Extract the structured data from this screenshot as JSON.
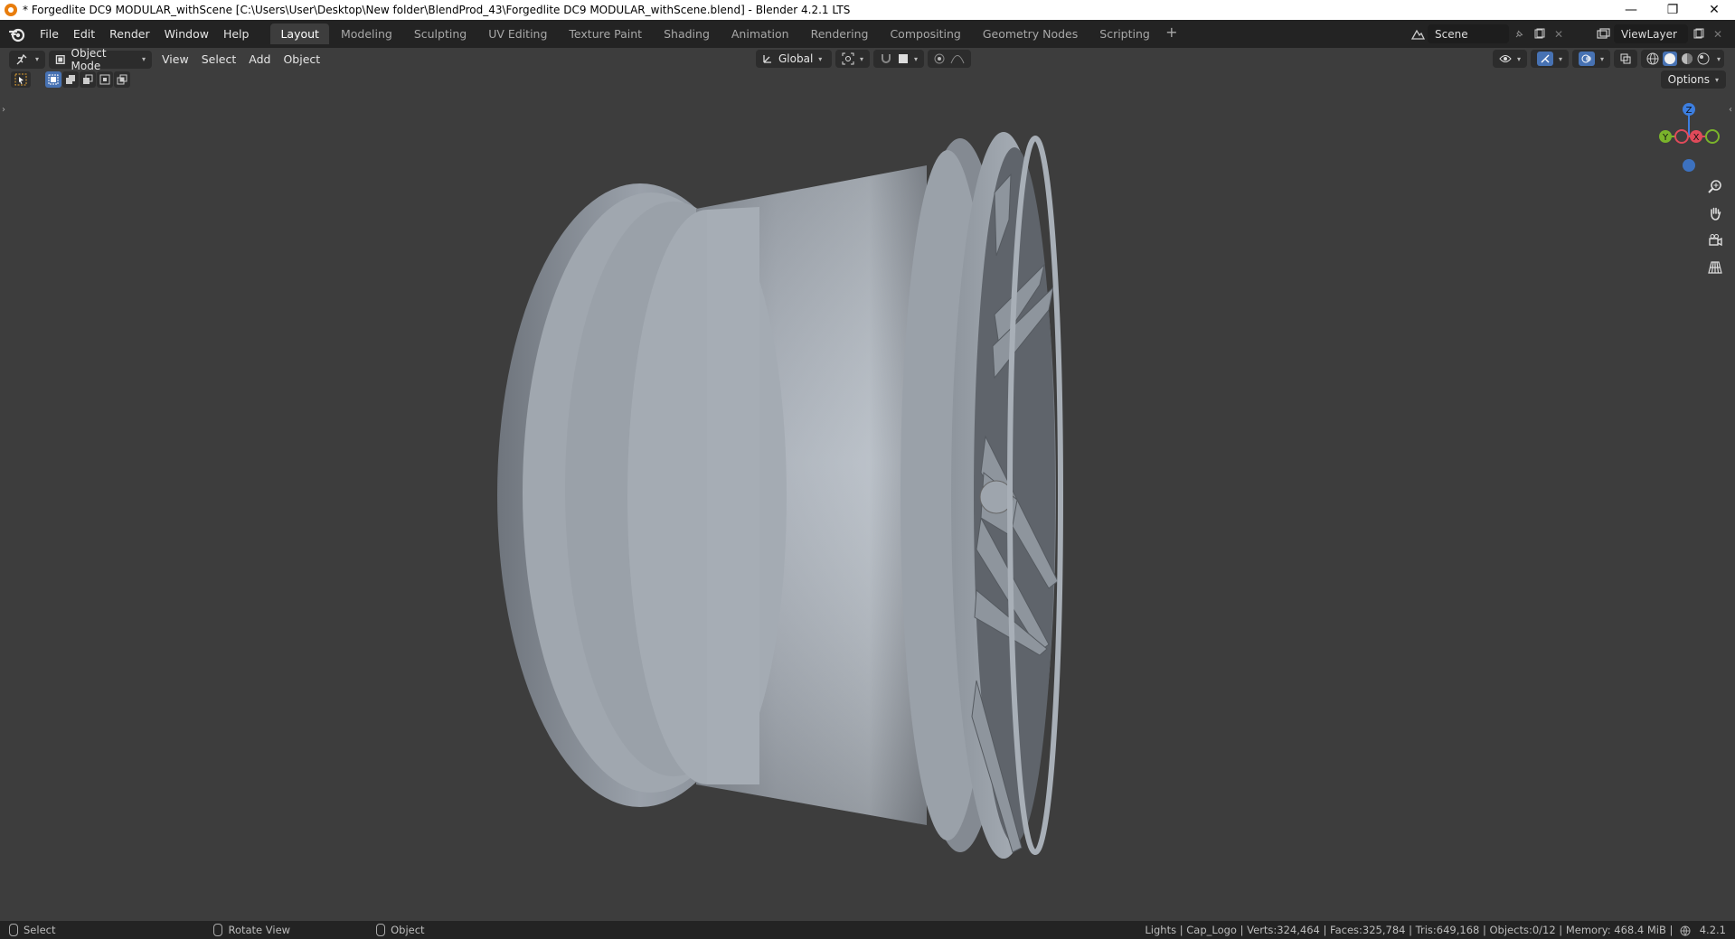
{
  "window": {
    "title": "* Forgedlite DC9 MODULAR_withScene [C:\\Users\\User\\Desktop\\New folder\\BlendProd_43\\Forgedlite DC9 MODULAR_withScene.blend] - Blender 4.2.1 LTS",
    "minimize": "—",
    "restore": "❐",
    "close": "✕"
  },
  "menu": [
    "File",
    "Edit",
    "Render",
    "Window",
    "Help"
  ],
  "workspaces": [
    {
      "label": "Layout",
      "active": true
    },
    {
      "label": "Modeling"
    },
    {
      "label": "Sculpting"
    },
    {
      "label": "UV Editing"
    },
    {
      "label": "Texture Paint"
    },
    {
      "label": "Shading"
    },
    {
      "label": "Animation"
    },
    {
      "label": "Rendering"
    },
    {
      "label": "Compositing"
    },
    {
      "label": "Geometry Nodes"
    },
    {
      "label": "Scripting"
    }
  ],
  "workspace_add": "+",
  "scene": {
    "label": "Scene"
  },
  "view_layer": {
    "label": "ViewLayer"
  },
  "viewport_header": {
    "mode": "Object Mode",
    "menus": [
      "View",
      "Select",
      "Add",
      "Object"
    ],
    "transform_orientation": "Global",
    "options": "Options"
  },
  "gizmo": {
    "z": "Z",
    "y": "Y",
    "x": "X"
  },
  "status": {
    "hints": [
      "Select",
      "Rotate View",
      "Object"
    ],
    "stats": "Lights | Cap_Logo | Verts:324,464 | Faces:325,784 | Tris:649,168 | Objects:0/12 | Memory: 468.4 MiB |",
    "version": "4.2.1"
  },
  "colors": {
    "background": "#3d3d3d",
    "topbar": "#232323",
    "accent": "#4772b3",
    "axis_x": "#e04a5a",
    "axis_y": "#7ab32b",
    "axis_z": "#3c7ee0"
  }
}
